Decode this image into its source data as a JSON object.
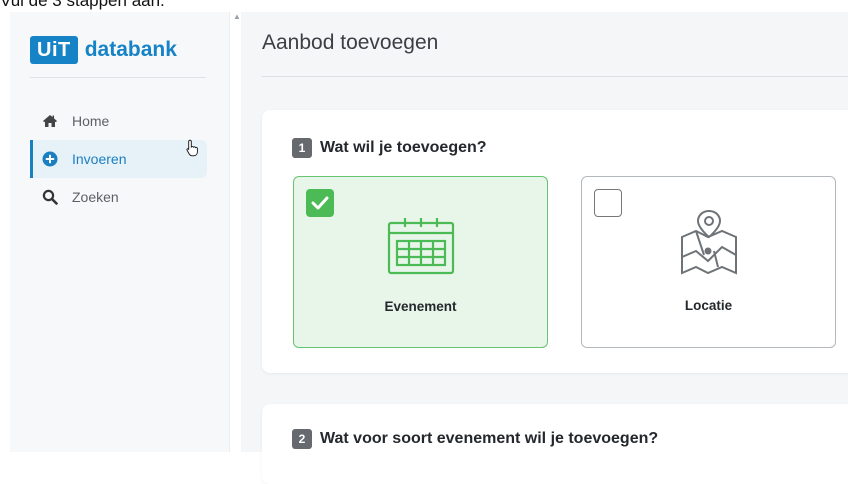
{
  "caption": "Vul de 3 stappen aan.",
  "brand": {
    "badge": "UiT",
    "name": "databank",
    "color": "#1783c7"
  },
  "nav": {
    "items": [
      {
        "label": "Home",
        "icon": "home-icon"
      },
      {
        "label": "Invoeren",
        "icon": "plus-circle-icon",
        "active": true
      },
      {
        "label": "Zoeken",
        "icon": "search-icon"
      }
    ]
  },
  "header": {
    "title": "Aanbod toevoegen"
  },
  "steps": [
    {
      "number": "1",
      "title": "Wat wil je toevoegen?",
      "options": [
        {
          "label": "Evenement",
          "icon": "calendar-icon",
          "selected": true
        },
        {
          "label": "Locatie",
          "icon": "map-pin-icon",
          "selected": false
        }
      ]
    },
    {
      "number": "2",
      "title": "Wat voor soort evenement wil je toevoegen?"
    }
  ],
  "colors": {
    "accent": "#1a7fc1",
    "selected_green": "#4cbb55",
    "selected_bg": "#e8f6ea"
  }
}
